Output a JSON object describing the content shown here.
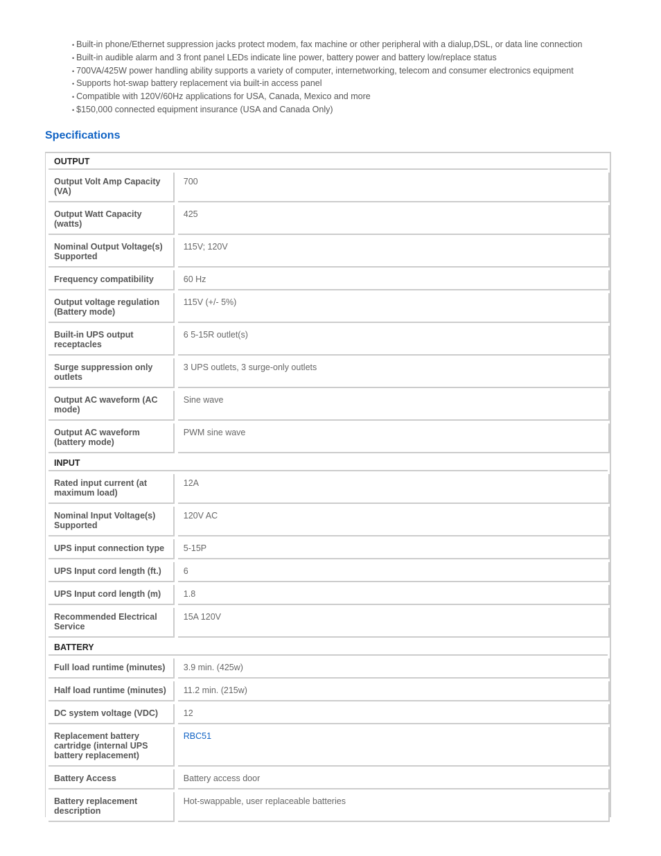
{
  "features": [
    "Built-in phone/Ethernet suppression jacks protect modem, fax machine or other peripheral with a dialup,DSL, or data line connection",
    "Built-in audible alarm and 3 front panel LEDs indicate line power, battery power and battery low/replace status",
    "700VA/425W power handling ability supports a variety of computer, internetworking, telecom and consumer electronics equipment",
    "Supports hot-swap battery replacement via built-in access panel",
    "Compatible with 120V/60Hz applications for USA, Canada, Mexico and more",
    "$150,000 connected equipment insurance (USA and Canada Only)"
  ],
  "specs_title": "Specifications",
  "link_color": "#0f62c4",
  "sections": [
    {
      "title": "OUTPUT",
      "rows": [
        {
          "label": "Output Volt Amp Capacity (VA)",
          "value": "700"
        },
        {
          "label": "Output Watt Capacity (watts)",
          "value": "425"
        },
        {
          "label": "Nominal Output Voltage(s) Supported",
          "value": "115V; 120V"
        },
        {
          "label": "Frequency compatibility",
          "value": "60 Hz"
        },
        {
          "label": "Output voltage regulation (Battery mode)",
          "value": "115V (+/- 5%)"
        },
        {
          "label": "Built-in UPS output receptacles",
          "value": "6 5-15R outlet(s)"
        },
        {
          "label": "Surge suppression only outlets",
          "value": "3 UPS outlets, 3 surge-only outlets"
        },
        {
          "label": "Output AC waveform (AC mode)",
          "value": "Sine wave"
        },
        {
          "label": "Output AC waveform (battery mode)",
          "value": "PWM sine wave"
        }
      ]
    },
    {
      "title": "INPUT",
      "rows": [
        {
          "label": "Rated input current (at maximum load)",
          "value": "12A"
        },
        {
          "label": "Nominal Input Voltage(s) Supported",
          "value": "120V AC"
        },
        {
          "label": "UPS input connection type",
          "value": "5-15P"
        },
        {
          "label": "UPS Input cord length (ft.)",
          "value": "6"
        },
        {
          "label": "UPS Input cord length (m)",
          "value": "1.8"
        },
        {
          "label": "Recommended Electrical Service",
          "value": "15A 120V"
        }
      ]
    },
    {
      "title": "BATTERY",
      "rows": [
        {
          "label": "Full load runtime (minutes)",
          "value": "3.9 min. (425w)"
        },
        {
          "label": "Half load runtime (minutes)",
          "value": "11.2 min. (215w)"
        },
        {
          "label": "DC system voltage (VDC)",
          "value": "12"
        },
        {
          "label": "Replacement battery cartridge (internal UPS battery replacement)",
          "value": "RBC51",
          "link": true
        },
        {
          "label": "Battery Access",
          "value": "Battery access door"
        },
        {
          "label": "Battery replacement description",
          "value": "Hot-swappable, user replaceable batteries"
        }
      ]
    }
  ]
}
